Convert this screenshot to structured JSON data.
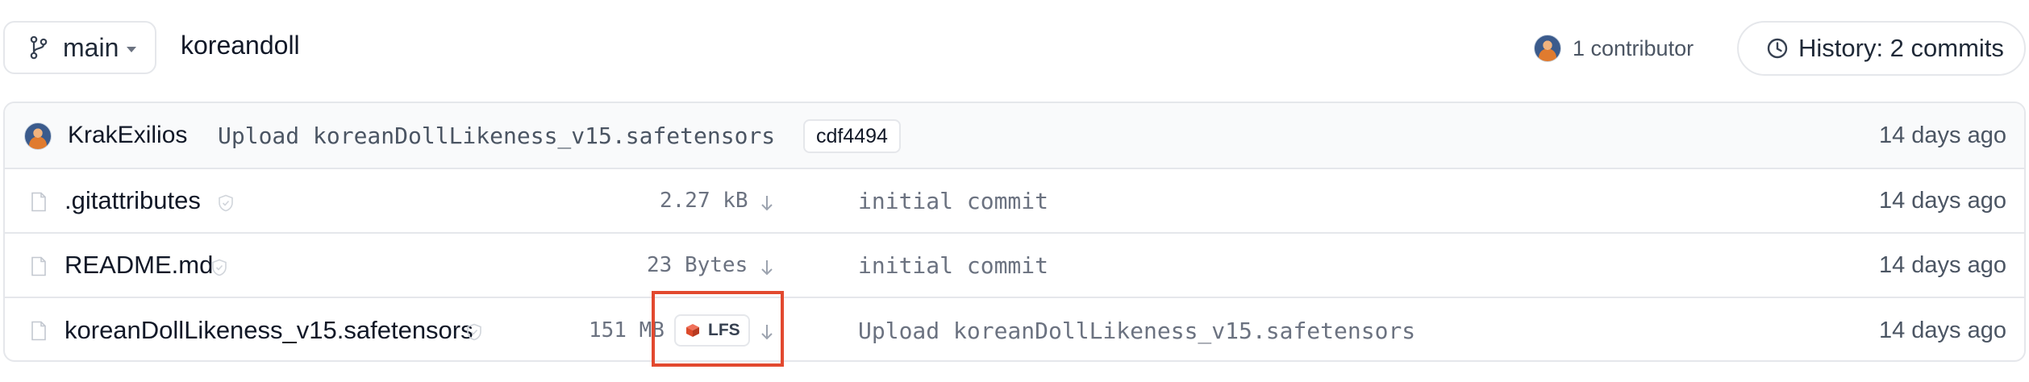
{
  "header": {
    "branch": "main",
    "repo_name": "koreandoll",
    "contributors_label": "1 contributor",
    "history_label": "History: 2 commits"
  },
  "last_commit": {
    "author": "KrakExilios",
    "message": "Upload koreanDollLikeness_v15.safetensors",
    "hash": "cdf4494",
    "date": "14 days ago"
  },
  "files": [
    {
      "name": ".gitattributes",
      "size": "2.27 kB",
      "message": "initial commit",
      "date": "14 days ago"
    },
    {
      "name": "README.md",
      "size": "23 Bytes",
      "message": "initial commit",
      "date": "14 days ago"
    },
    {
      "name": "koreanDollLikeness_v15.safetensors",
      "size": "151 MB",
      "lfs_label": "LFS",
      "message": "Upload koreanDollLikeness_v15.safetensors",
      "date": "14 days ago"
    }
  ],
  "colors": {
    "highlight": "#e2492f",
    "lfs_accent": "#dc4a2b"
  },
  "icons": [
    "branch-icon",
    "chevron-down-icon",
    "clock-icon",
    "file-icon",
    "shield-check-icon",
    "download-icon",
    "lfs-icon"
  ]
}
